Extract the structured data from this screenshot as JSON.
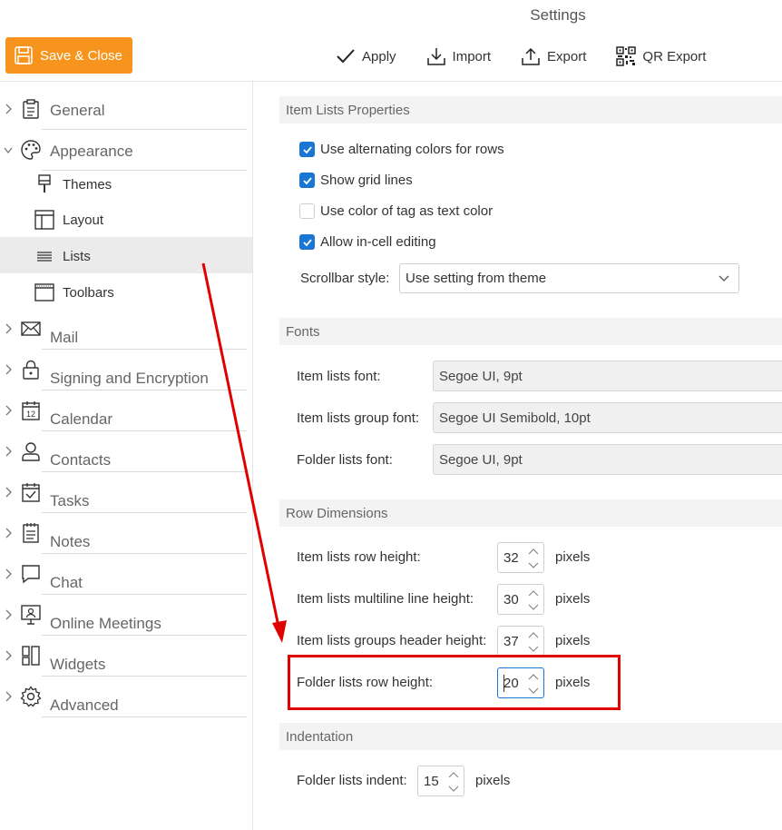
{
  "window": {
    "title": "Settings"
  },
  "toolbar": {
    "save_close": "Save & Close",
    "apply": "Apply",
    "import": "Import",
    "export": "Export",
    "qr_export": "QR Export"
  },
  "sidebar": {
    "general": "General",
    "appearance": "Appearance",
    "themes": "Themes",
    "layout": "Layout",
    "lists": "Lists",
    "toolbars": "Toolbars",
    "mail": "Mail",
    "signing": "Signing and Encryption",
    "calendar": "Calendar",
    "calendar_icon_number": "12",
    "contacts": "Contacts",
    "tasks": "Tasks",
    "notes": "Notes",
    "chat": "Chat",
    "online_meetings": "Online Meetings",
    "widgets": "Widgets",
    "advanced": "Advanced"
  },
  "item_lists_properties": {
    "header": "Item Lists Properties",
    "alternating_colors": {
      "label": "Use alternating colors for rows",
      "checked": true
    },
    "grid_lines": {
      "label": "Show grid lines",
      "checked": true
    },
    "tag_color": {
      "label": "Use color of tag as text color",
      "checked": false
    },
    "in_cell_editing": {
      "label": "Allow in-cell editing",
      "checked": true
    },
    "scrollbar_label": "Scrollbar style:",
    "scrollbar_value": "Use setting from theme"
  },
  "fonts": {
    "header": "Fonts",
    "item_lists_label": "Item lists font:",
    "item_lists_value": "Segoe UI, 9pt",
    "group_label": "Item lists group font:",
    "group_value": "Segoe UI Semibold, 10pt",
    "folder_label": "Folder lists font:",
    "folder_value": "Segoe UI, 9pt"
  },
  "row_dimensions": {
    "header": "Row Dimensions",
    "unit": "pixels",
    "item_row_height_label": "Item lists row height:",
    "item_row_height_value": "32",
    "multiline_label": "Item lists multiline line height:",
    "multiline_value": "30",
    "group_header_label": "Item lists groups header height:",
    "group_header_value": "37",
    "folder_row_height_label": "Folder lists row height:",
    "folder_row_height_value": "20"
  },
  "indentation": {
    "header": "Indentation",
    "folder_indent_label": "Folder lists indent:",
    "folder_indent_value": "15",
    "unit": "pixels"
  },
  "colors": {
    "accent": "#1976d2",
    "save_button": "#f7941d",
    "annotation": "#e00000"
  }
}
